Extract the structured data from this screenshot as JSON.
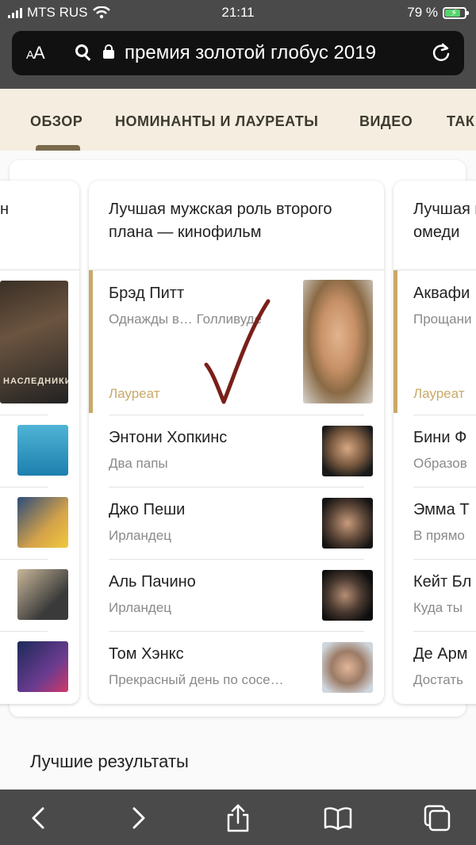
{
  "status_bar": {
    "carrier": "MTS RUS",
    "time": "21:11",
    "battery": "79 %",
    "battery_level": 0.79
  },
  "url_bar": {
    "aa_label": "AA",
    "query": "премия золотой глобус 2019"
  },
  "tabs": [
    {
      "label": "ОБЗОР",
      "active": true
    },
    {
      "label": "НОМИНАНТЫ И ЛАУРЕАТЫ",
      "active": false
    },
    {
      "label": "ВИДЕО",
      "active": false
    },
    {
      "label": "ТАК",
      "active": false
    }
  ],
  "left_card": {
    "snippets": [
      "н",
      "."
    ],
    "posters": [
      "НАСЛЕДНИКИ"
    ]
  },
  "center_card": {
    "title": "Лучшая мужская роль второго плана — кинофильм",
    "winner": {
      "name": "Брэд Питт",
      "film": "Однажды в… Голливуде",
      "badge": "Лауреат"
    },
    "nominees": [
      {
        "name": "Энтони Хопкинс",
        "film": "Два папы"
      },
      {
        "name": "Джо Пеши",
        "film": "Ирландец"
      },
      {
        "name": "Аль Пачино",
        "film": "Ирландец"
      },
      {
        "name": "Том Хэнкс",
        "film": "Прекрасный день по сосе…"
      }
    ]
  },
  "right_card": {
    "title": "Лучшая комеди",
    "winner": {
      "name": "Аквафи",
      "film": "Прощани",
      "badge": "Лауреат"
    },
    "nominees": [
      {
        "name": "Бини Ф",
        "film": "Образов"
      },
      {
        "name": "Эмма Т",
        "film": "В прямо"
      },
      {
        "name": "Кейт Бл",
        "film": "Куда ты"
      },
      {
        "name": "Де Арм",
        "film": "Достать"
      }
    ]
  },
  "results_title": "Лучшие результаты",
  "toolbar": [
    "back-icon",
    "forward-icon",
    "share-icon",
    "bookmarks-icon",
    "tabs-icon"
  ],
  "colors": {
    "accent_gold": "#c9a96a",
    "chrome": "#4a4a4a",
    "tab_bg": "#f4ede0",
    "checkmark": "#7a1f1a"
  }
}
